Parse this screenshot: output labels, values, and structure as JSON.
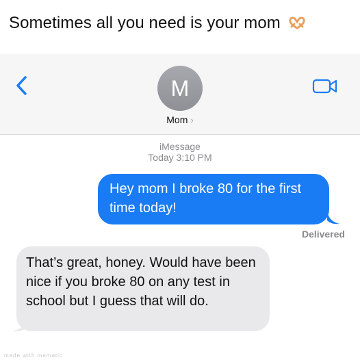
{
  "caption": {
    "text": "Sometimes all you need is your mom",
    "emoji": "heart-hands-emoji"
  },
  "header": {
    "avatar_initial": "M",
    "contact_name": "Mom",
    "chevron": "›",
    "back_icon": "chevron-left-icon",
    "video_icon": "video-camera-icon"
  },
  "conversation": {
    "service": "iMessage",
    "timestamp": "Today 3:10 PM",
    "messages": [
      {
        "direction": "outgoing",
        "text": "Hey mom I broke 80 for the first time today!"
      },
      {
        "direction": "incoming",
        "text": "That’s great, honey. Would have been nice if you broke 80 on any test in school but I guess that will do."
      }
    ],
    "status": "Delivered"
  },
  "watermark": "made with mematic",
  "colors": {
    "accent": "#1a7cf5",
    "outgoing_bubble": "#1a7cf5",
    "incoming_bubble": "#e9e9eb",
    "header_bg": "#f6f6f6",
    "meta_text": "#8a8a8e"
  }
}
